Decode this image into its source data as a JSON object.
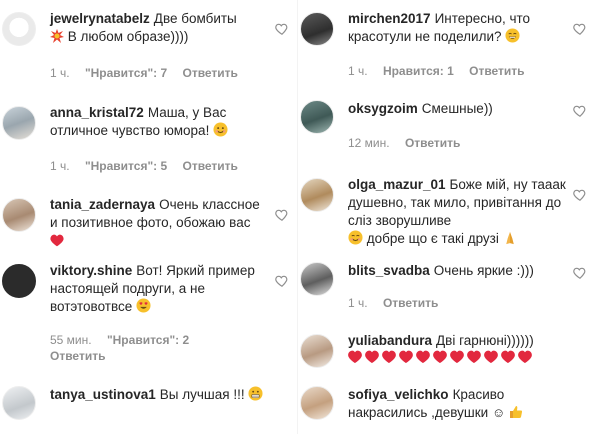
{
  "left": [
    {
      "username": "jewelrynatabelz",
      "text_before": "Две бомбиты",
      "text_after": "В любом образе))))",
      "time": "1 ч.",
      "likes": "\"Нравится\": 7",
      "reply": "Ответить"
    },
    {
      "username": "anna_kristal72",
      "text": "Маша, у Вас отличное чувство юмора!",
      "time": "1 ч.",
      "likes": "\"Нравится\": 5",
      "reply": "Ответить"
    },
    {
      "username": "tania_zadernaya",
      "text": "Очень классное и позитивное фото, обожаю вас",
      "time": "",
      "likes": "",
      "reply": ""
    },
    {
      "username": "viktory.shine",
      "text": "Вот! Яркий пример настоящей подруги, а не вотэтовотвсе",
      "time": "55 мин.",
      "likes": "\"Нравится\": 2",
      "reply": "Ответить"
    },
    {
      "username": "tanya_ustinova1",
      "text": "Вы лучшая !!!"
    }
  ],
  "right": [
    {
      "username": "mirchen2017",
      "text": "Интересно, что красотули не поделили?",
      "time": "1 ч.",
      "likes": "Нравится: 1",
      "reply": "Ответить"
    },
    {
      "username": "oksygzoim",
      "text": "Смешные))",
      "time": "12 мин.",
      "reply": "Ответить"
    },
    {
      "username": "olga_mazur_01",
      "text": "Боже мій, ну тааак душевно, так мило, привітання до сліз зворушливе",
      "text_after": "добре що є такі друзі"
    },
    {
      "username": "blits_svadba",
      "text": "Очень яркие :)))",
      "time": "1 ч.",
      "reply": "Ответить"
    },
    {
      "username": "yuliabandura",
      "text": "Дві гарнюні))))))"
    },
    {
      "username": "sofiya_velichko",
      "text": "Красиво накрасились ,девушки"
    }
  ],
  "colors": {
    "text": "#262626",
    "meta": "#8e8e8e",
    "heart_red": "#ed4956",
    "emoji_yellow": "#f7c02b"
  }
}
